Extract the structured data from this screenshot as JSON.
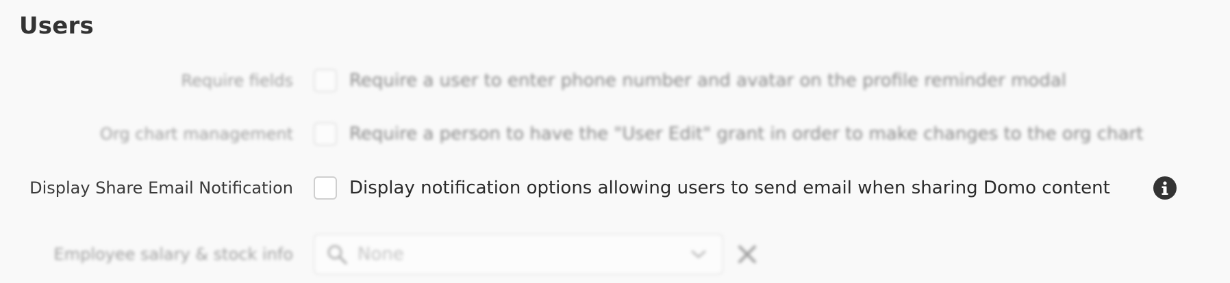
{
  "section": {
    "title": "Users"
  },
  "settings": {
    "require_fields": {
      "label": "Require fields",
      "description": "Require a user to enter phone number and avatar on the profile reminder modal"
    },
    "org_chart": {
      "label": "Org chart management",
      "description": "Require a person to have the \"User Edit\" grant in order to make changes to the org chart"
    },
    "share_email": {
      "label": "Display Share Email Notification",
      "description": "Display notification options allowing users to send email when sharing Domo content",
      "info_icon": "info-icon"
    },
    "salary_stock": {
      "label": "Employee salary & stock info",
      "select_value": "None",
      "search_icon": "search-icon",
      "chevron_icon": "chevron-down-icon",
      "clear_icon": "close-icon"
    }
  }
}
